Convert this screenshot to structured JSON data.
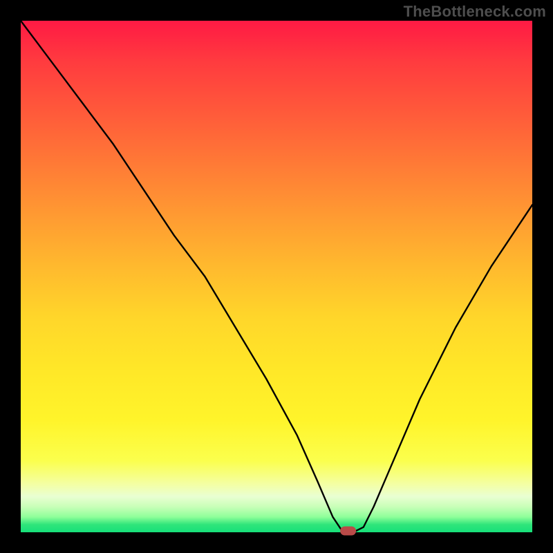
{
  "watermark": "TheBottleneck.com",
  "chart_data": {
    "type": "line",
    "title": "",
    "xlabel": "",
    "ylabel": "",
    "xlim": [
      0,
      100
    ],
    "ylim": [
      0,
      100
    ],
    "grid": false,
    "legend": false,
    "series": [
      {
        "name": "bottleneck-curve",
        "x": [
          0,
          6,
          12,
          18,
          24,
          30,
          36,
          42,
          48,
          54,
          58,
          61,
          63,
          65,
          67,
          69,
          72,
          78,
          85,
          92,
          100
        ],
        "y": [
          100,
          92,
          84,
          76,
          67,
          58,
          50,
          40,
          30,
          19,
          10,
          3,
          0,
          0,
          1,
          5,
          12,
          26,
          40,
          52,
          64
        ]
      }
    ],
    "annotations": [
      {
        "name": "optimal-point",
        "x": 64,
        "y": 0,
        "shape": "pill",
        "color": "#b94a48"
      }
    ],
    "background_gradient_stops": [
      {
        "pos": 0.0,
        "color": "#ff1a44"
      },
      {
        "pos": 0.5,
        "color": "#ffd62a"
      },
      {
        "pos": 0.9,
        "color": "#f4ffa2"
      },
      {
        "pos": 1.0,
        "color": "#17e07a"
      }
    ]
  }
}
